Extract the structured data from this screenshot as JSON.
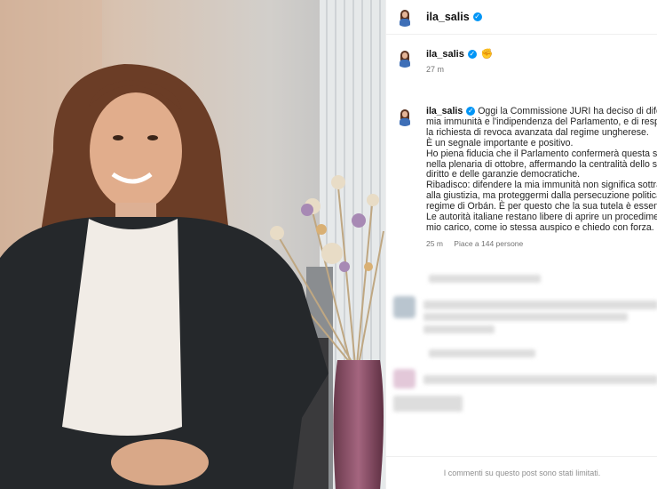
{
  "post": {
    "username": "ila_salis",
    "verified_mark": "✓"
  },
  "reply": {
    "username": "ila_salis",
    "emoji": "✊",
    "time": "27 m"
  },
  "caption": {
    "username": "ila_salis",
    "lines": [
      "Oggi la Commissione JURI ha deciso di difendere la",
      "mia immunità e l'indipendenza del Parlamento, e di respingere",
      "la richiesta di revoca avanzata dal regime ungherese.",
      "È un segnale importante e positivo.",
      "Ho piena fiducia che il Parlamento confermerà questa scelta",
      "nella plenaria di ottobre, affermando la centralità dello stato di",
      "diritto e delle garanzie democratiche.",
      "Ribadisco: difendere la mia immunità non significa sottrarmi",
      "alla giustizia, ma proteggermi dalla persecuzione politica del",
      "regime di Orbán. È per questo che la sua tutela è essenziale.",
      "Le autorità italiane restano libere di aprire un procedimento a",
      "mio carico, come io stessa auspico e chiedo con forza."
    ],
    "time": "25 m",
    "likes": "Piace a 144 persone"
  },
  "footer": {
    "text": "I commenti su questo post sono stati limitati."
  },
  "colors": {
    "accent": "#0095f6",
    "muted": "#737373"
  },
  "icons": [
    "verified-badge-icon",
    "raised-fist-icon"
  ]
}
